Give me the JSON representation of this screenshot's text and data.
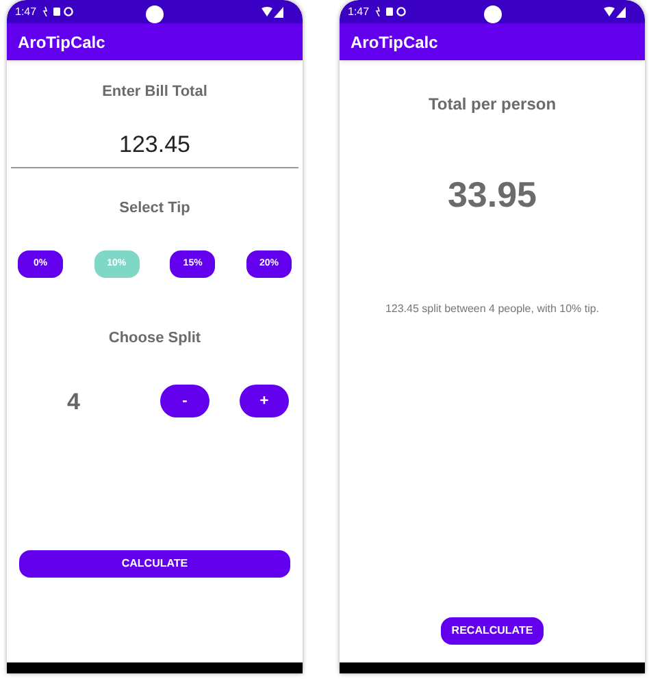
{
  "screens": [
    {
      "kind": "input",
      "status_bar": {
        "time": "1:47"
      },
      "app_bar": {
        "title": "AroTipCalc"
      },
      "bill": {
        "label": "Enter Bill Total",
        "value": "123.45"
      },
      "tip": {
        "label": "Select Tip",
        "options": [
          {
            "label": "0%",
            "selected": false
          },
          {
            "label": "10%",
            "selected": true
          },
          {
            "label": "15%",
            "selected": false
          },
          {
            "label": "20%",
            "selected": false
          }
        ]
      },
      "split": {
        "label": "Choose Split",
        "value": "4",
        "decrement": "-",
        "increment": "+"
      },
      "action": "CALCULATE"
    },
    {
      "kind": "result",
      "status_bar": {
        "time": "1:47"
      },
      "app_bar": {
        "title": "AroTipCalc"
      },
      "heading": "Total per person",
      "amount": "33.95",
      "summary": "123.45 split between 4 people, with 10% tip.",
      "action": "RECALCULATE"
    }
  ]
}
